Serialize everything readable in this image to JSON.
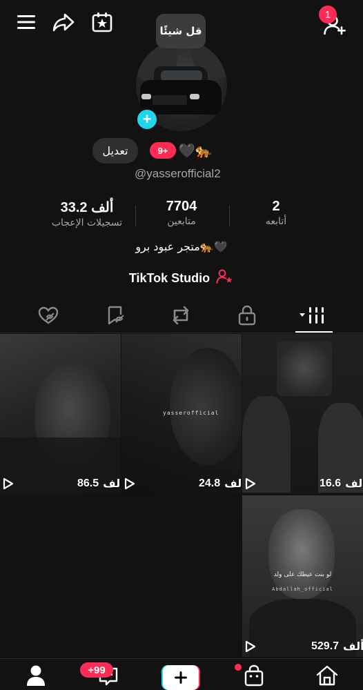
{
  "notifications_count": "1",
  "tooltip_text": "قل شيئًا",
  "profile": {
    "edit_label": "تعديل",
    "badge": "9+",
    "emojis": "🖤🐅",
    "handle": "@yasserofficial2",
    "bio": "متجر عبود برو🐅🖤",
    "studio_label": "TikTok Studio"
  },
  "stats": {
    "likes_value": "33.2 ألف",
    "likes_label": "تسجيلات الإعجاب",
    "followers_value": "7704",
    "followers_label": "متابعين",
    "following_value": "2",
    "following_label": "أتابعه"
  },
  "videos": [
    {
      "views": "86.5",
      "unit": "ألف",
      "watermark": ""
    },
    {
      "views": "24.8",
      "unit": "ألف",
      "watermark": "yasserofficial"
    },
    {
      "views": "16.6",
      "unit": "ألف",
      "watermark": ""
    },
    {
      "views": "529.7",
      "unit": "ألف",
      "watermark": "Abdallah_official",
      "caption": "لو بنت عيطك على ولد"
    }
  ],
  "bottom_nav": {
    "inbox_badge": "+99"
  },
  "colors": {
    "background": "#121212",
    "accent_red": "#fe2c55",
    "accent_cyan": "#20d5ec"
  },
  "icons": [
    "menu-icon",
    "share-icon",
    "calendar-star-icon",
    "add-friend-icon",
    "liked-hidden-icon",
    "favorites-icon",
    "repost-icon",
    "private-lock-icon",
    "grid-icon",
    "profile-icon",
    "inbox-icon",
    "create-icon",
    "shop-icon",
    "home-icon"
  ]
}
